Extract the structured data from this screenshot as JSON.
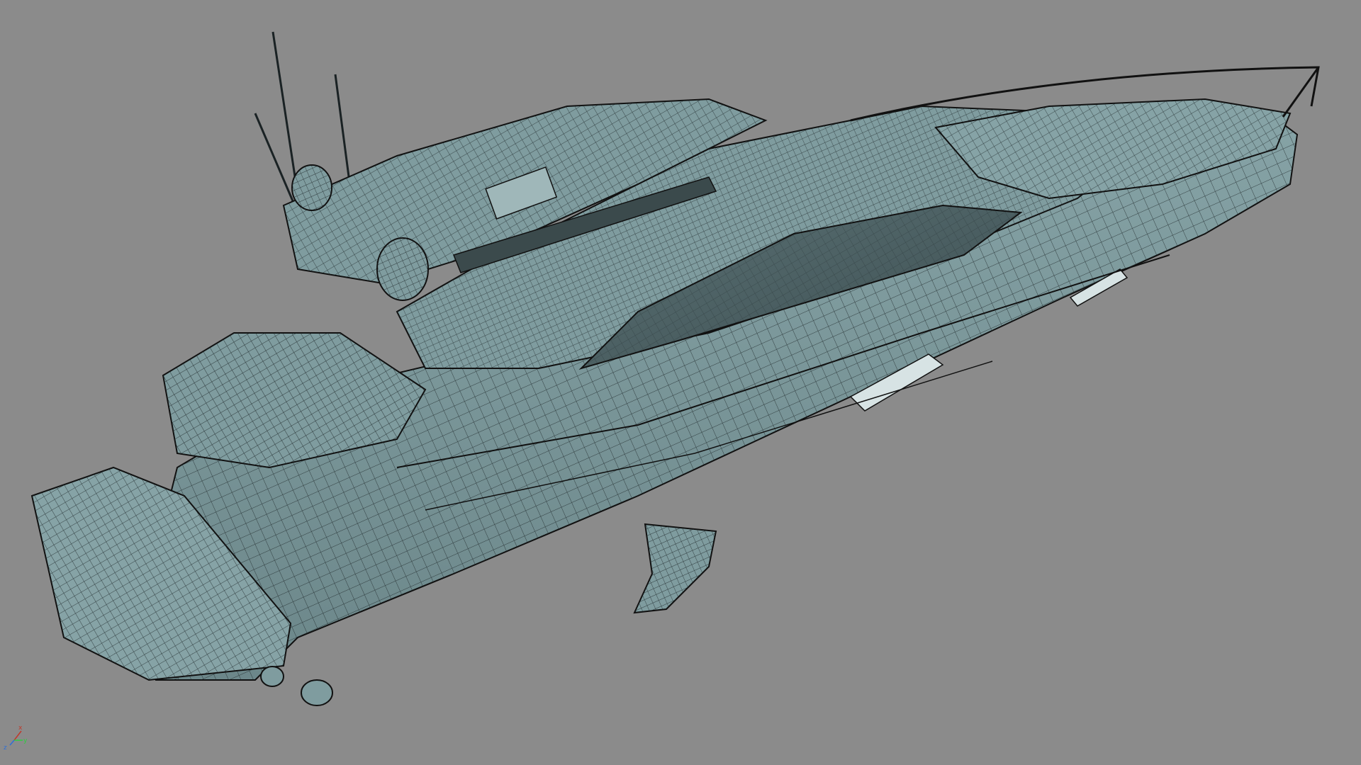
{
  "viewport": {
    "background": "#8b8b8b",
    "shading": "wireframe-on-shaded",
    "surface_color": "#7f9c9f",
    "wire_color": "#1a2224"
  },
  "model": {
    "icon": "yacht-3d-model"
  },
  "axis_gizmo": {
    "x_label": "x",
    "y_label": "y",
    "z_label": "z",
    "x_color": "#c0392b",
    "y_color": "#2ecc40",
    "z_color": "#2f6fd6"
  }
}
